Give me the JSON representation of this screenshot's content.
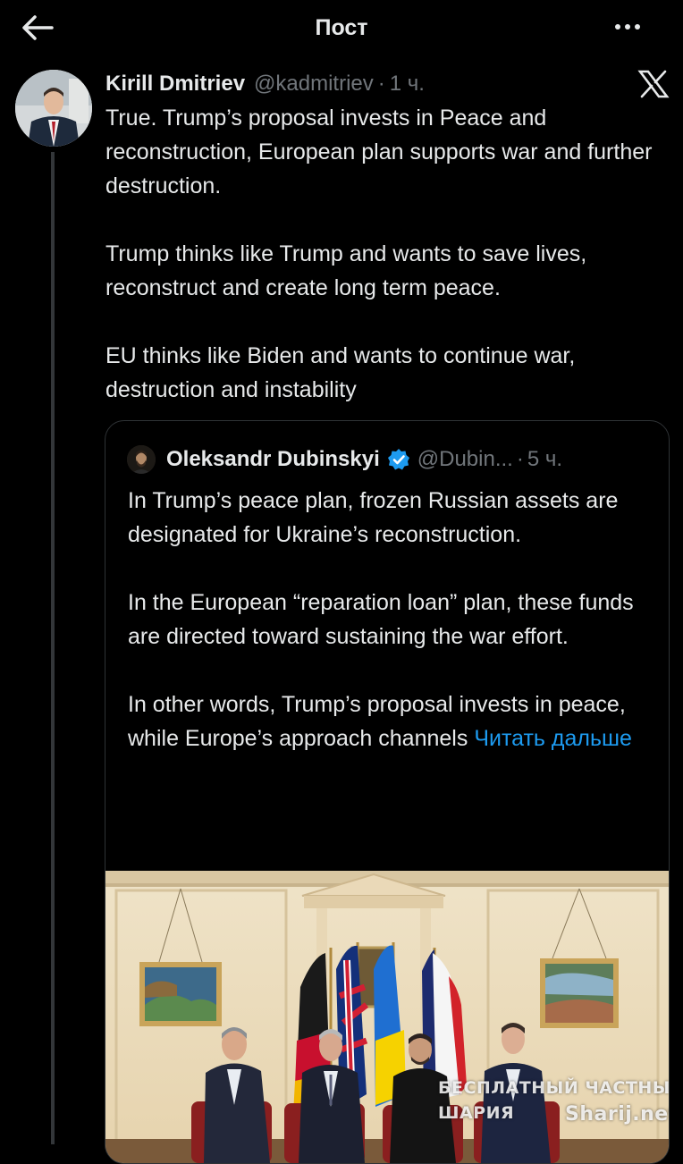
{
  "header": {
    "title": "Пост",
    "icons": {
      "back": "arrow-left-icon",
      "more": "more-horizontal-icon"
    }
  },
  "tweet": {
    "author_name": "Kirill Dmitriev",
    "author_handle": "@kadmitriev",
    "separator": "·",
    "time": "1 ч.",
    "platform_icon": "x-logo-icon",
    "paragraphs": [
      "True. Trump’s proposal invests in Peace and reconstruction, European plan supports war and further destruction.",
      "Trump thinks like Trump and wants to save lives, reconstruct and create long term peace.",
      "EU thinks like Biden and wants to continue war, destruction and instability"
    ]
  },
  "quote": {
    "author_name": "Oleksandr Dubinskyi",
    "verified_icon": "verified-badge-icon",
    "author_handle": "@Dubin...",
    "separator": "·",
    "time": "5 ч.",
    "paragraphs": [
      "In Trump’s peace plan, frozen Russian assets are designated for Ukraine’s reconstruction.",
      "In the European “reparation loan” plan, these funds are directed toward sustaining the war effort."
    ],
    "last_paragraph_text": "In other words, Trump’s proposal invests in peace, while Europe’s approach channels",
    "read_more": "Читать дальше",
    "watermark": {
      "line1": "БЕСПЛАТНЫЙ ЧАСТНЫЙ",
      "line2_left": "ШАРИЯ",
      "line2_right": "Sharij.net"
    }
  },
  "colors": {
    "background": "#000000",
    "text": "#e7e9ea",
    "secondary": "#71767b",
    "link": "#1d9bf0",
    "border": "#2f3336"
  }
}
